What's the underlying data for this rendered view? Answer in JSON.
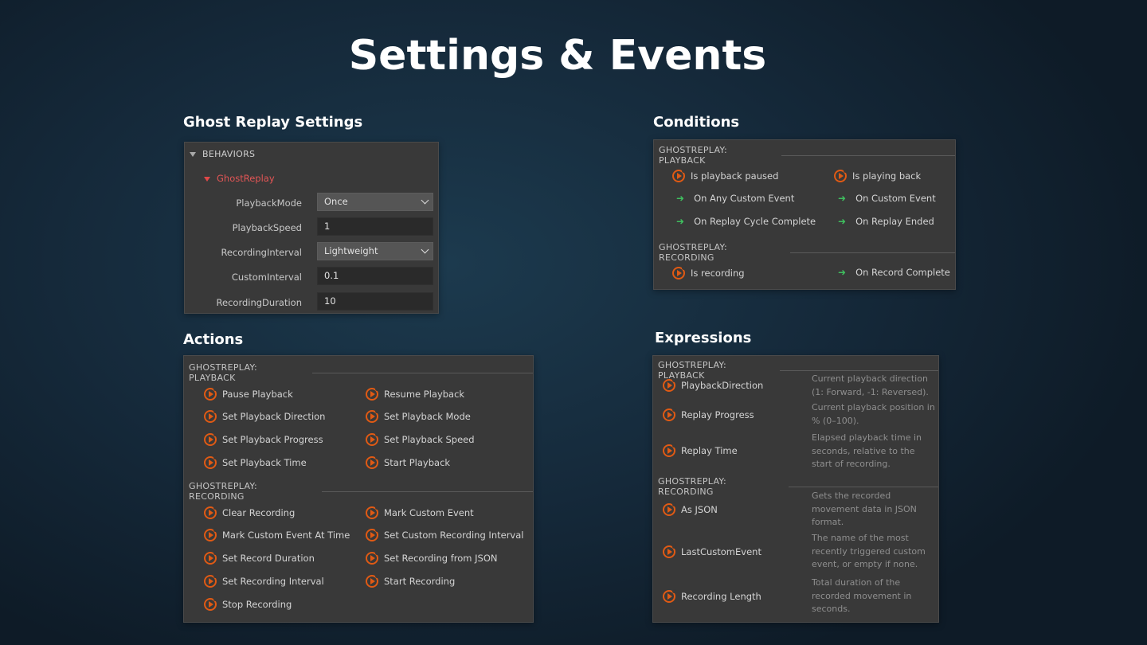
{
  "page_title": "Settings & Events",
  "sections": {
    "settings_title": "Ghost Replay Settings",
    "conditions_title": "Conditions",
    "actions_title": "Actions",
    "expressions_title": "Expressions"
  },
  "settings": {
    "behaviors_label": "BEHAVIORS",
    "behavior_name": "GhostReplay",
    "properties": [
      {
        "label": "PlaybackMode",
        "value": "Once",
        "type": "select"
      },
      {
        "label": "PlaybackSpeed",
        "value": "1",
        "type": "text"
      },
      {
        "label": "RecordingInterval",
        "value": "Lightweight",
        "type": "select"
      },
      {
        "label": "CustomInterval",
        "value": "0.1",
        "type": "text"
      },
      {
        "label": "RecordingDuration",
        "value": "10",
        "type": "text"
      }
    ]
  },
  "conditions": {
    "playback_heading": "GHOSTREPLAY: PLAYBACK",
    "playback_items": [
      {
        "label": "Is playback paused",
        "icon": "replay-icon"
      },
      {
        "label": "Is playing back",
        "icon": "replay-icon"
      },
      {
        "label": "On Any Custom Event",
        "icon": "trigger-arrow-icon"
      },
      {
        "label": "On Custom Event",
        "icon": "trigger-arrow-icon"
      },
      {
        "label": "On Replay Cycle Complete",
        "icon": "trigger-arrow-icon"
      },
      {
        "label": "On Replay Ended",
        "icon": "trigger-arrow-icon"
      }
    ],
    "recording_heading": "GHOSTREPLAY: RECORDING",
    "recording_items": [
      {
        "label": "Is recording",
        "icon": "replay-icon"
      },
      {
        "label": "On Record Complete",
        "icon": "trigger-arrow-icon"
      }
    ]
  },
  "actions": {
    "playback_heading": "GHOSTREPLAY: PLAYBACK",
    "playback_items": [
      "Pause Playback",
      "Resume Playback",
      "Set Playback Direction",
      "Set Playback Mode",
      "Set Playback Progress",
      "Set Playback Speed",
      "Set Playback Time",
      "Start Playback"
    ],
    "recording_heading": "GHOSTREPLAY: RECORDING",
    "recording_items": [
      "Clear Recording",
      "Mark Custom Event",
      "Mark Custom Event At Time",
      "Set Custom Recording Interval",
      "Set Record Duration",
      "Set Recording from JSON",
      "Set Recording Interval",
      "Start Recording",
      "Stop Recording"
    ]
  },
  "expressions": {
    "playback_heading": "GHOSTREPLAY: PLAYBACK",
    "playback_items": [
      {
        "name": "PlaybackDirection",
        "desc": "Current playback direction (1: Forward, -1: Reversed)."
      },
      {
        "name": "Replay Progress",
        "desc": "Current playback position in % (0–100)."
      },
      {
        "name": "Replay Time",
        "desc": "Elapsed playback time in seconds, relative to the start of recording."
      }
    ],
    "recording_heading": "GHOSTREPLAY: RECORDING",
    "recording_items": [
      {
        "name": "As JSON",
        "desc": "Gets the recorded movement data in JSON format."
      },
      {
        "name": "LastCustomEvent",
        "desc": "The name of the most recently triggered custom event, or empty if none."
      },
      {
        "name": "Recording Length",
        "desc": "Total duration of the recorded movement in seconds."
      }
    ]
  },
  "colors": {
    "accent_orange": "#e05a14",
    "trigger_green": "#3fbf5f",
    "behavior_red": "#e25555"
  }
}
